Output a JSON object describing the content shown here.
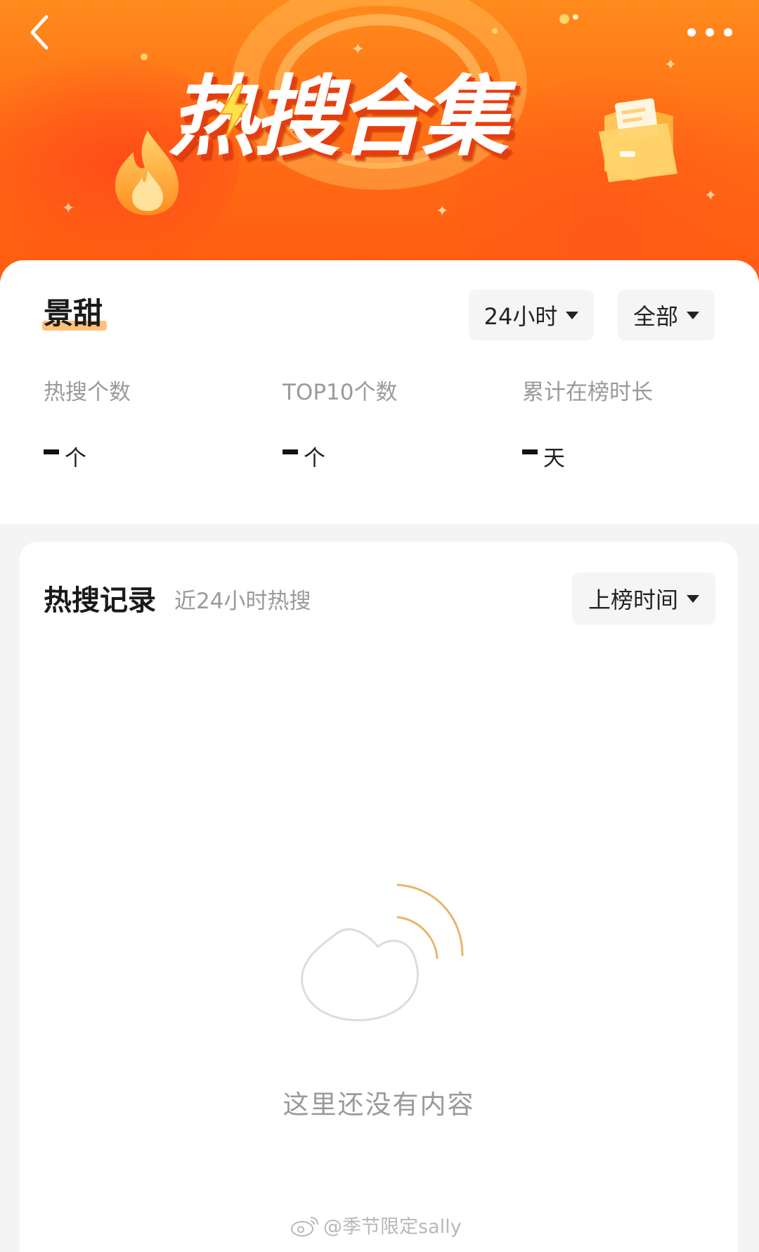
{
  "banner": {
    "title": "热搜合集",
    "back_icon": "chevron-left-icon",
    "more_icon": "more-dots-icon"
  },
  "summary": {
    "name": "景甜",
    "time_filter": "24小时",
    "scope_filter": "全部",
    "stats": [
      {
        "label": "热搜个数",
        "value": "",
        "unit": "个"
      },
      {
        "label": "TOP10个数",
        "value": "",
        "unit": "个"
      },
      {
        "label": "累计在榜时长",
        "value": "",
        "unit": "天"
      }
    ]
  },
  "records": {
    "title": "热搜记录",
    "subtitle": "近24小时热搜",
    "sort_label": "上榜时间",
    "empty_text": "这里还没有内容"
  },
  "watermark": {
    "text": "@季节限定sally"
  },
  "colors": {
    "banner_orange": "#ff6a14",
    "highlight": "#ffc178",
    "muted_text": "#9a9a9a",
    "empty_arc": "#e9b56a"
  }
}
